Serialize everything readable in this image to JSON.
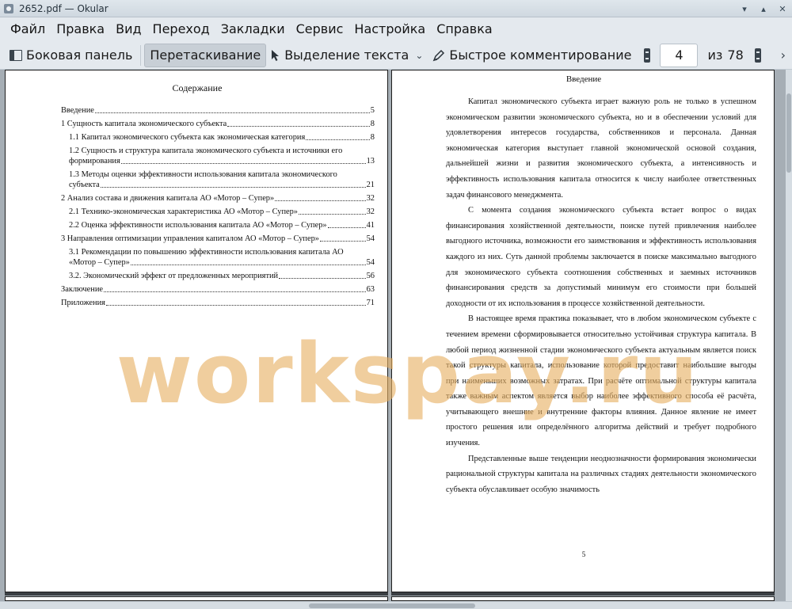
{
  "window": {
    "title": "2652.pdf — Okular",
    "controls": [
      "minimize",
      "maximize",
      "close"
    ]
  },
  "menu": {
    "items": [
      "Файл",
      "Правка",
      "Вид",
      "Переход",
      "Закладки",
      "Сервис",
      "Настройка",
      "Справка"
    ]
  },
  "toolbar": {
    "sidebar_label": "Боковая панель",
    "drag_label": "Перетаскивание",
    "select_label": "Выделение текста",
    "comment_label": "Быстрое комментирование",
    "page_current": "4",
    "page_of": "из",
    "page_total": "78"
  },
  "toc": {
    "heading": "Содержание",
    "entries": [
      {
        "title": "Введение",
        "page": "5"
      },
      {
        "title": "1 Сущность капитала экономического субъекта",
        "page": "8"
      },
      {
        "title": "1.1 Капитал экономического субъекта как экономическая категория",
        "page": "8"
      },
      {
        "title": "1.2 Сущность и структура капитала экономического субъекта и источники его",
        "title2": "формирования",
        "page": "13"
      },
      {
        "title": "1.3 Методы оценки эффективности использования капитала экономического",
        "title2": "субъекта",
        "page": "21"
      },
      {
        "title": "2 Анализ состава и движения капитала АО «Мотор – Супер»",
        "page": "32"
      },
      {
        "title": "2.1 Технико-экономическая характеристика АО «Мотор – Супер»",
        "page": "32"
      },
      {
        "title": "2.2 Оценка эффективности использования капитала АО «Мотор – Супер»",
        "page": "41"
      },
      {
        "title": "3 Направления оптимизации управления капиталом АО «Мотор – Супер»",
        "page": "54"
      },
      {
        "title": "3.1 Рекомендации по повышению эффективности использования капитала АО",
        "title2": "«Мотор – Супер»",
        "page": "54"
      },
      {
        "title": "3.2. Экономический эффект от предложенных мероприятий",
        "page": "56"
      },
      {
        "title": "Заключение",
        "page": "63"
      },
      {
        "title": "Приложения",
        "page": "71"
      }
    ]
  },
  "intro": {
    "heading": "Введение",
    "paragraphs": [
      "Капитал экономического субъекта играет важную роль не только в успешном экономическом развитии экономического субъекта, но и в обеспечении условий для удовлетворения интересов государства, собственников и персонала. Данная экономическая категория выступает главной экономической основой создания, дальнейшей жизни и развития экономического субъекта, а интенсивность и эффективность использования капитала относится к числу наиболее ответственных задач финансового менеджмента.",
      "С момента создания экономического субъекта встает вопрос о видах финансирования хозяйственной деятельности, поиске путей привлечения наиболее выгодного источника, возможности его заимствования и эффективность использования каждого из них. Суть данной проблемы заключается в поиске максимально выгодного для экономического субъекта соотношения собственных и заемных источников финансирования средств за допустимый минимум его стоимости при большей доходности от их использования в процессе хозяйственной деятельности.",
      "В настоящее время практика показывает, что в любом экономическом субъекте с течением времени сформировывается относительно устойчивая структура капитала. В любой период жизненной стадии экономического субъекта актуальным является поиск такой структуры капитала, использование которой предоставит наибольшие выгоды при наименьших возможных затратах. При расчёте оптимальной структуры капитала также важным аспектом является выбор наиболее эффективного способа её расчёта, учитывающего внешние и внутренние факторы влияния. Данное явление не имеет простого решения или определённого алгоритма действий и требует подробного изучения.",
      "Представленные выше тенденции неоднозначности формирования экономически рациональной структуры капитала на различных стадиях деятельности экономического субъекта обуславливает особую значимость"
    ],
    "page_number": "5"
  },
  "watermark": "workspay.ru"
}
